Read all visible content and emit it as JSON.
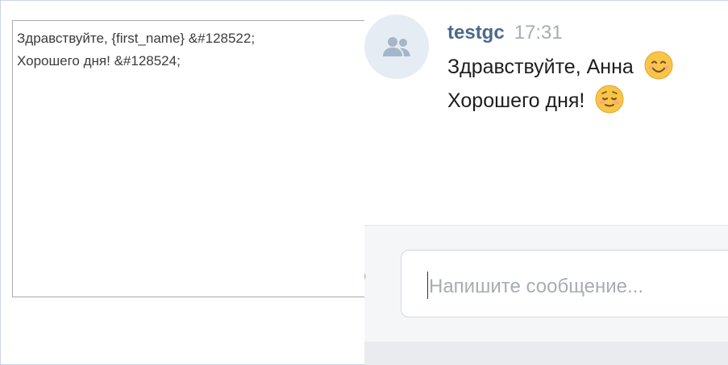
{
  "editor": {
    "lines": [
      "Здравствуйте, {first_name} &#128522;",
      "Хорошего дня! &#128524;"
    ]
  },
  "chat": {
    "avatar_icon": "group-users-icon",
    "message": {
      "author": "testgc",
      "time": "17:31",
      "lines": [
        {
          "text": "Здравствуйте, Анна",
          "emoji": "smiling-face-emoji"
        },
        {
          "text": "Хорошего дня!",
          "emoji": "relieved-face-emoji"
        }
      ]
    },
    "composer": {
      "placeholder": "Напишите сообщение..."
    }
  },
  "colors": {
    "author": "#4a6a8c",
    "time": "#a5adb6",
    "emoji_face": "#f7c548"
  }
}
